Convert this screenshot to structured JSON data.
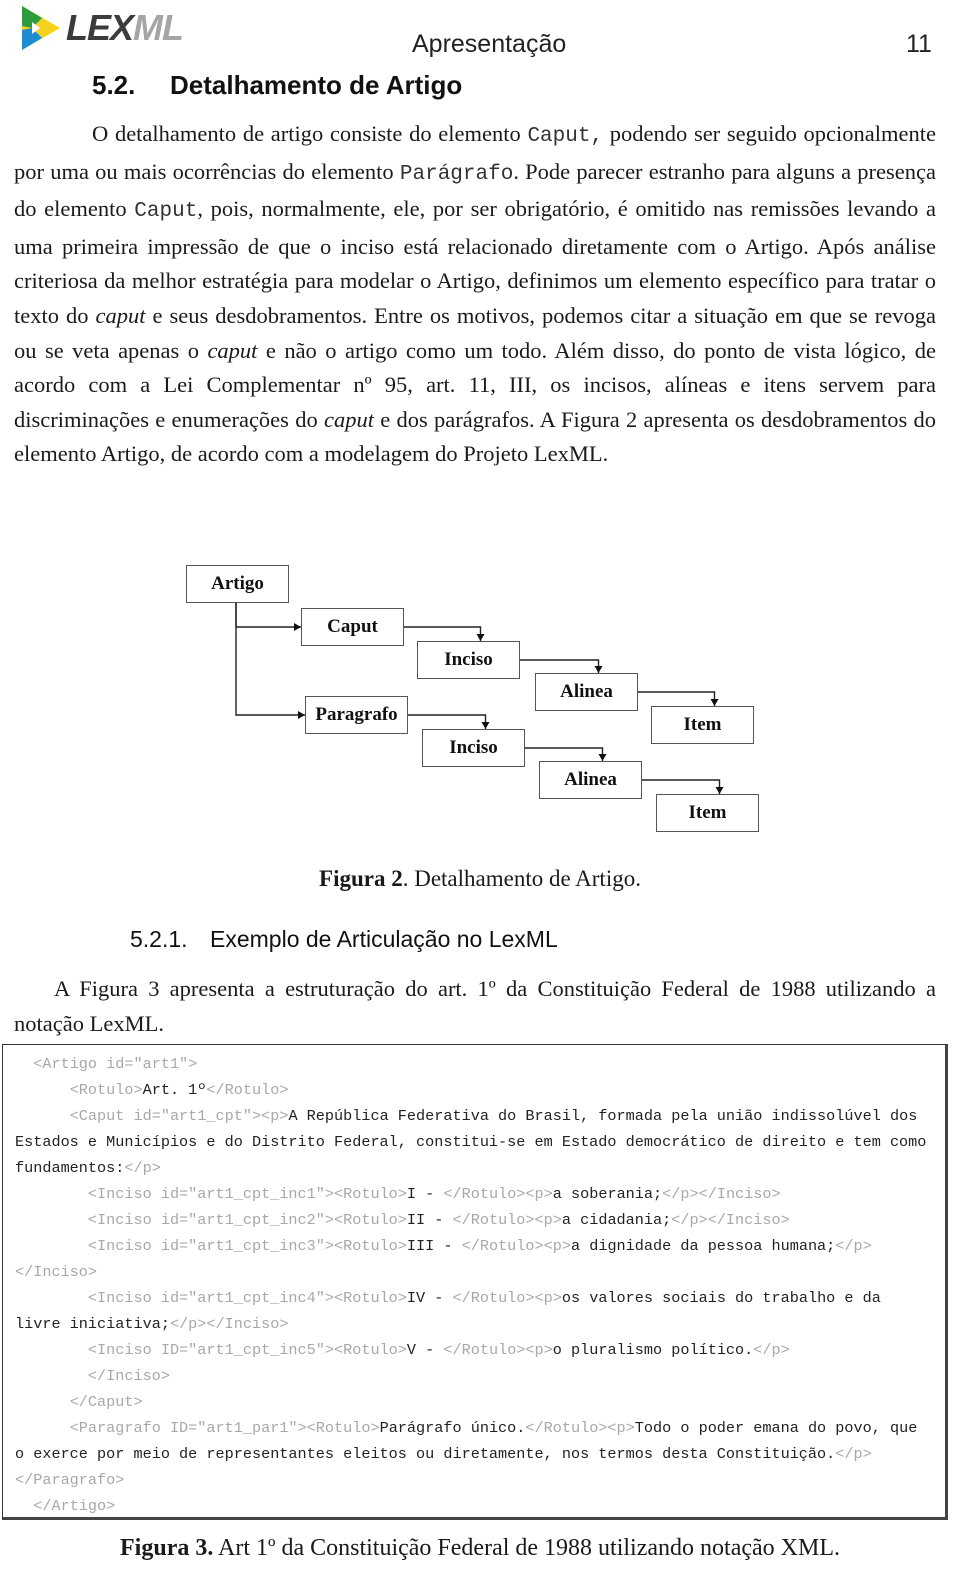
{
  "header": {
    "logo": {
      "icon": "lexml-arrow-logo-icon",
      "text_dark": "LEX",
      "text_light": "ML",
      "colors": [
        "#2e9b3c",
        "#f4d21e",
        "#1f8bd1"
      ]
    },
    "running_title": "Apresentação",
    "page_number": "11"
  },
  "section": {
    "number": "5.2.",
    "title": "Detalhamento de Artigo"
  },
  "paragraph1": {
    "segments": [
      {
        "t": "O detalhamento de artigo consiste do elemento "
      },
      {
        "t": "Caput,",
        "style": "mono"
      },
      {
        "t": " podendo ser seguido opcionalmente por uma ou mais ocorrências do elemento "
      },
      {
        "t": "Parágrafo",
        "style": "mono"
      },
      {
        "t": ". Pode parecer estranho para alguns a presença do elemento "
      },
      {
        "t": "Caput",
        "style": "mono"
      },
      {
        "t": ", pois, normalmente, ele, por ser obrigatório, é omitido nas remissões levando a uma primeira impressão de que o inciso está relacionado diretamente com o Artigo. Após análise criteriosa da melhor estratégia para modelar o Artigo, definimos um elemento específico para tratar o texto do "
      },
      {
        "t": "caput",
        "style": "italic"
      },
      {
        "t": " e seus desdobramentos. Entre os motivos, podemos citar a situação em que se revoga ou se veta apenas o "
      },
      {
        "t": "caput",
        "style": "italic"
      },
      {
        "t": " e não o artigo como um todo. Além disso, do ponto de vista lógico, de acordo com a Lei Complementar nº 95, art. 11, III, os incisos, alíneas e itens servem para discriminações e enumerações do "
      },
      {
        "t": "caput",
        "style": "italic"
      },
      {
        "t": " e dos parágrafos. A Figura 2 apresenta os desdobramentos do elemento Artigo, de acordo com a modelagem do Projeto LexML."
      }
    ]
  },
  "figure2": {
    "nodes": [
      {
        "id": "artigo",
        "label": "Artigo"
      },
      {
        "id": "caput",
        "label": "Caput"
      },
      {
        "id": "inciso1",
        "label": "Inciso"
      },
      {
        "id": "alinea1",
        "label": "Alinea"
      },
      {
        "id": "item1",
        "label": "Item"
      },
      {
        "id": "paragrafo",
        "label": "Paragrafo"
      },
      {
        "id": "inciso2",
        "label": "Inciso"
      },
      {
        "id": "alinea2",
        "label": "Alinea"
      },
      {
        "id": "item2",
        "label": "Item"
      }
    ],
    "edges": [
      [
        "artigo",
        "caput"
      ],
      [
        "artigo",
        "paragrafo"
      ],
      [
        "caput",
        "inciso1"
      ],
      [
        "inciso1",
        "alinea1"
      ],
      [
        "alinea1",
        "item1"
      ],
      [
        "paragrafo",
        "inciso2"
      ],
      [
        "inciso2",
        "alinea2"
      ],
      [
        "alinea2",
        "item2"
      ]
    ],
    "caption_label": "Figura 2",
    "caption_text": ". Detalhamento de Artigo."
  },
  "subsection": {
    "number": "5.2.1.",
    "title": "Exemplo de Articulação no LexML"
  },
  "paragraph2": {
    "text": "A Figura 3 apresenta a estruturação do art. 1º da Constituição Federal de 1988 utilizando a notação LexML."
  },
  "figure3": {
    "code_lines": [
      [
        {
          "tag": "  <Artigo id=\"art1\">"
        }
      ],
      [
        {
          "tag": "      <Rotulo>"
        },
        {
          "txt": "Art. 1º"
        },
        {
          "tag": "</Rotulo>"
        }
      ],
      [
        {
          "tag": "      <Caput id=\"art1_cpt\"><p>"
        },
        {
          "txt": "A República Federativa do Brasil, formada pela união indissolúvel dos Estados e Municípios e do Distrito Federal, constitui-se em Estado democrático de direito e tem como fundamentos:"
        },
        {
          "tag": "</p>"
        }
      ],
      [
        {
          "tag": "        <Inciso id=\"art1_cpt_inc1\"><Rotulo>"
        },
        {
          "txt": "I - "
        },
        {
          "tag": "</Rotulo><p>"
        },
        {
          "txt": "a soberania;"
        },
        {
          "tag": "</p></Inciso>"
        }
      ],
      [
        {
          "tag": "        <Inciso id=\"art1_cpt_inc2\"><Rotulo>"
        },
        {
          "txt": "II - "
        },
        {
          "tag": "</Rotulo><p>"
        },
        {
          "txt": "a cidadania;"
        },
        {
          "tag": "</p></Inciso>"
        }
      ],
      [
        {
          "tag": "        <Inciso id=\"art1_cpt_inc3\"><Rotulo>"
        },
        {
          "txt": "III - "
        },
        {
          "tag": "</Rotulo><p>"
        },
        {
          "txt": "a dignidade da pessoa humana;"
        },
        {
          "tag": "</p></Inciso>"
        }
      ],
      [
        {
          "tag": "        <Inciso id=\"art1_cpt_inc4\"><Rotulo>"
        },
        {
          "txt": "IV - "
        },
        {
          "tag": "</Rotulo><p>"
        },
        {
          "txt": "os valores sociais do trabalho e da livre iniciativa;"
        },
        {
          "tag": "</p></Inciso>"
        }
      ],
      [
        {
          "tag": "        <Inciso ID=\"art1_cpt_inc5\"><Rotulo>"
        },
        {
          "txt": "V - "
        },
        {
          "tag": "</Rotulo><p>"
        },
        {
          "txt": "o pluralismo político."
        },
        {
          "tag": "</p>"
        }
      ],
      [
        {
          "tag": "        </Inciso>"
        }
      ],
      [
        {
          "tag": "      </Caput>"
        }
      ],
      [
        {
          "tag": "      <Paragrafo ID=\"art1_par1\"><Rotulo>"
        },
        {
          "txt": "Parágrafo único."
        },
        {
          "tag": "</Rotulo><p>"
        },
        {
          "txt": "Todo o poder emana do povo, que o exerce por meio de representantes eleitos ou diretamente, nos termos desta Constituição."
        },
        {
          "tag": "</p></Paragrafo>"
        }
      ],
      [
        {
          "tag": "  </Artigo>"
        }
      ]
    ],
    "caption_label": "Figura 3.",
    "caption_text": " Art 1º da Constituição Federal de 1988 utilizando notação XML."
  }
}
